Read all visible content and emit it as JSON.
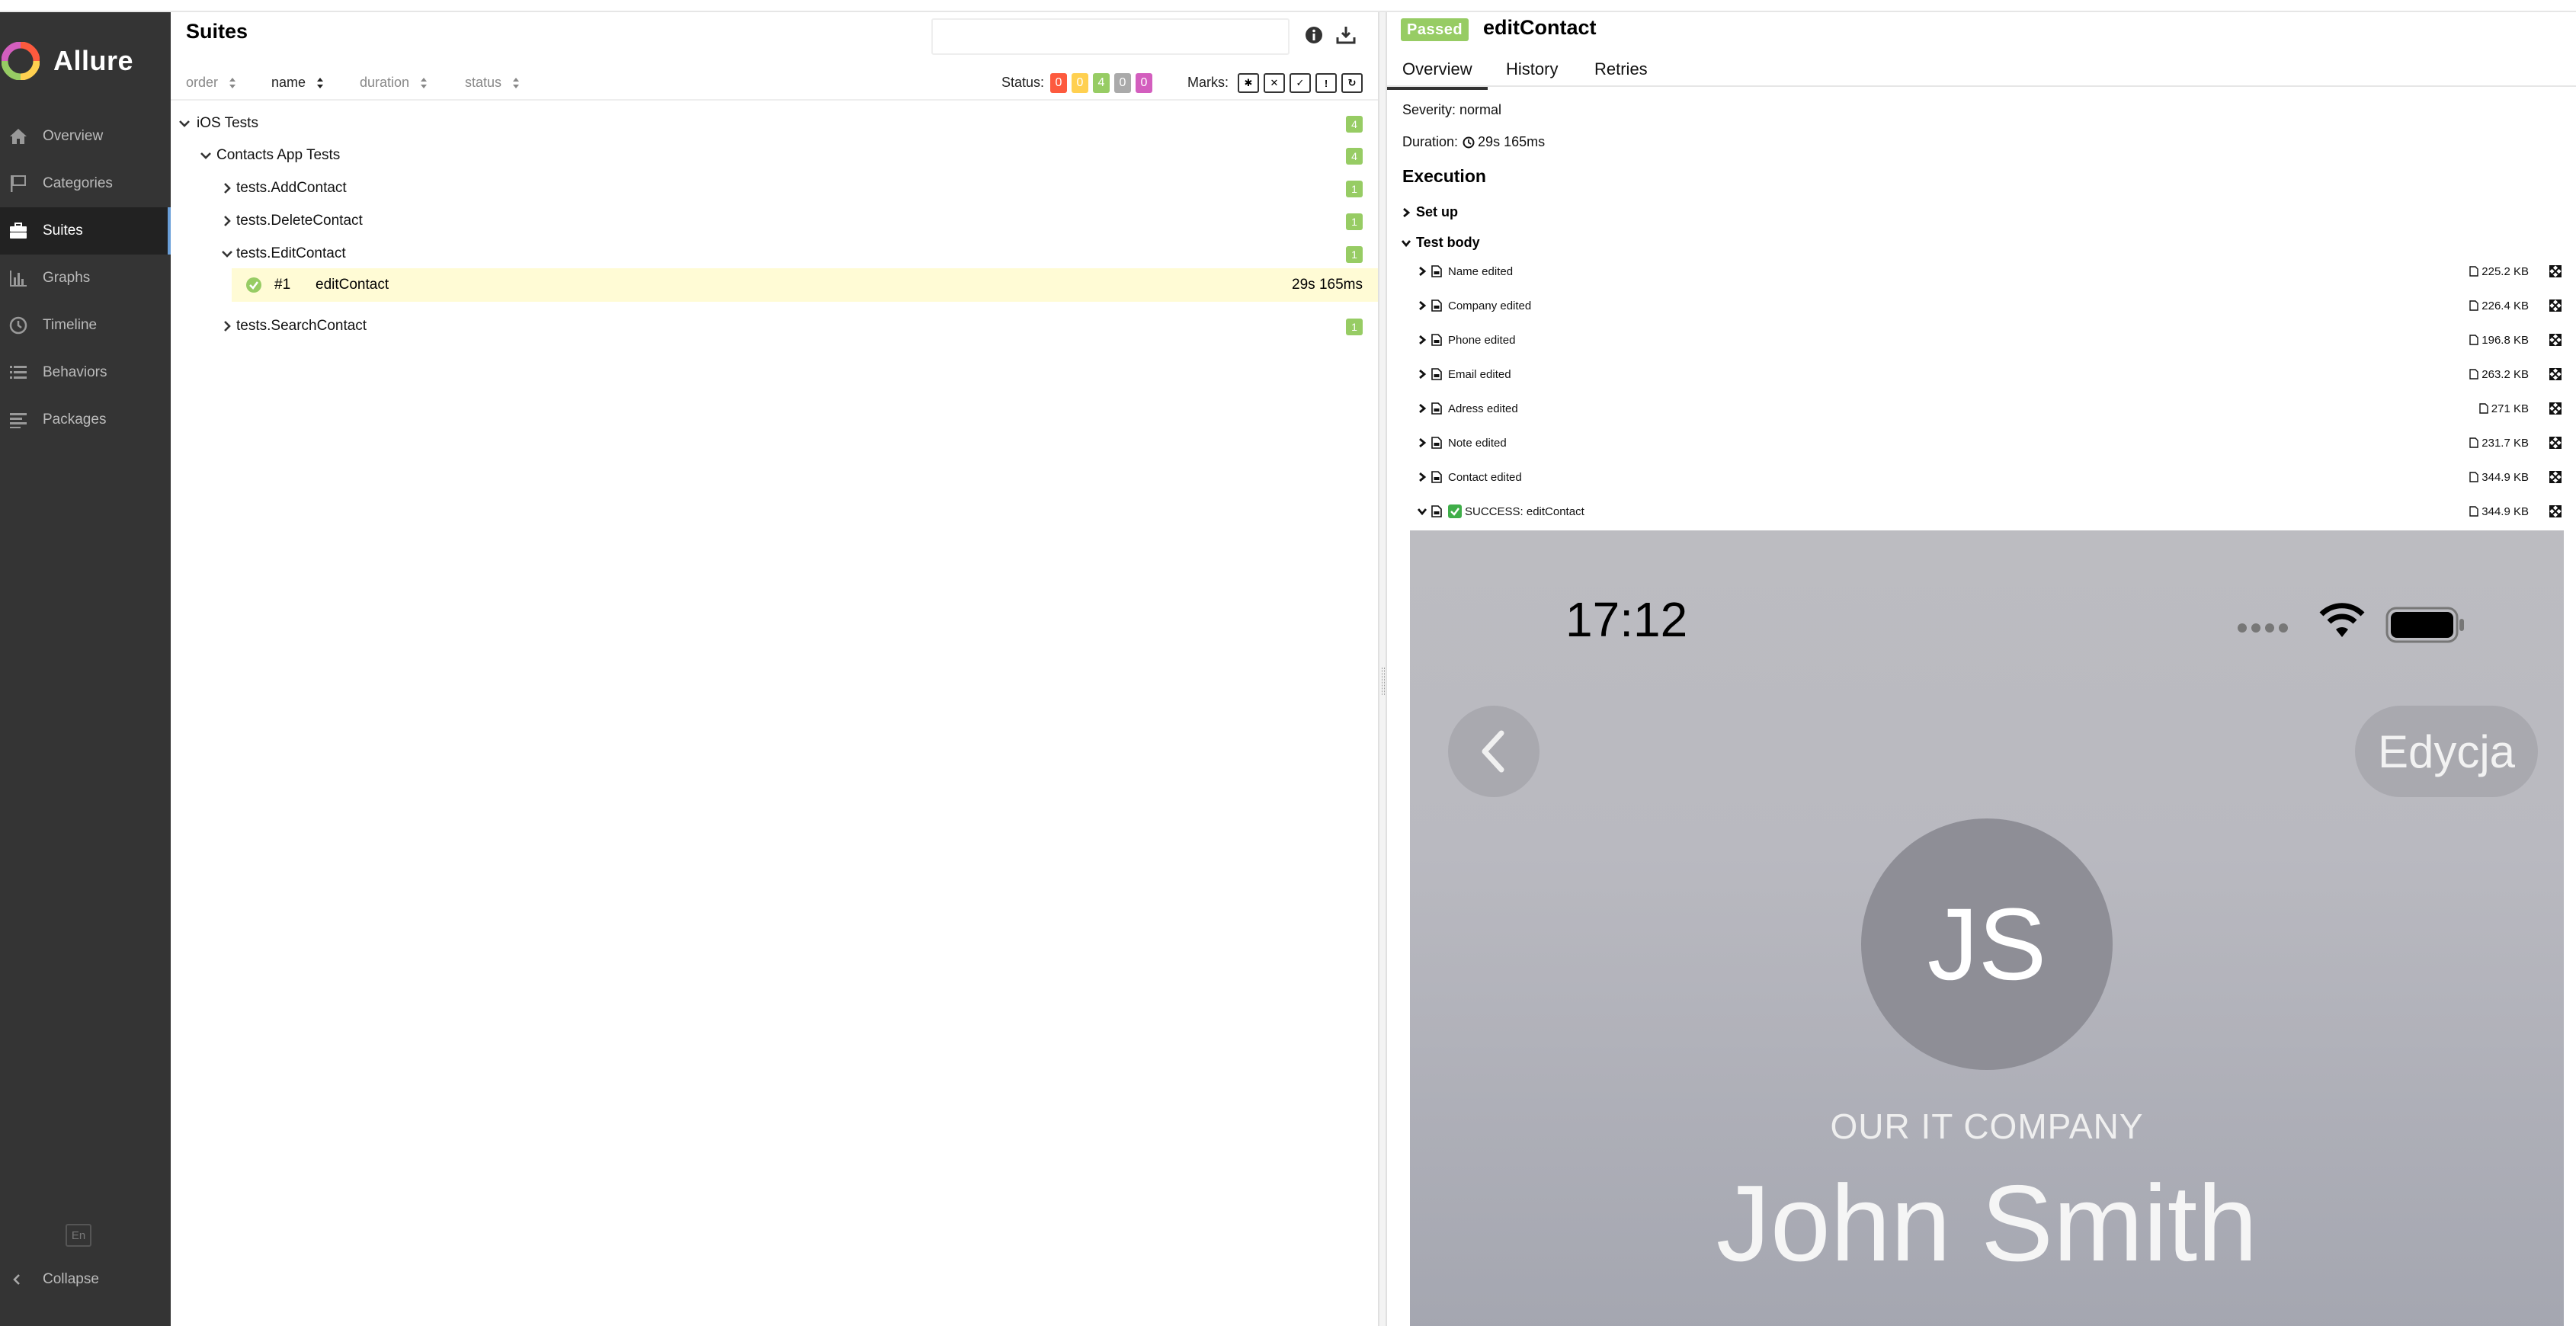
{
  "app": {
    "name": "Allure"
  },
  "sidebar": {
    "items": [
      {
        "label": "Overview",
        "icon": "home-icon"
      },
      {
        "label": "Categories",
        "icon": "flag-icon"
      },
      {
        "label": "Suites",
        "icon": "briefcase-icon"
      },
      {
        "label": "Graphs",
        "icon": "bar-chart-icon"
      },
      {
        "label": "Timeline",
        "icon": "clock-icon"
      },
      {
        "label": "Behaviors",
        "icon": "list-icon"
      },
      {
        "label": "Packages",
        "icon": "align-left-icon"
      }
    ],
    "active": "Suites",
    "lang": "En",
    "collapse_label": "Collapse"
  },
  "suites": {
    "title": "Suites",
    "search_placeholder": "",
    "sort": {
      "order": "order",
      "name": "name",
      "duration": "duration",
      "status": "status"
    },
    "status_label": "Status:",
    "status_counts": [
      {
        "value": "0",
        "color": "#fd5a3e"
      },
      {
        "value": "0",
        "color": "#ffd050"
      },
      {
        "value": "4",
        "color": "#97cc64"
      },
      {
        "value": "0",
        "color": "#aaaaaa"
      },
      {
        "value": "0",
        "color": "#d35ebe"
      }
    ],
    "marks_label": "Marks:",
    "marks": [
      "flaky-icon",
      "new-failed-icon",
      "new-passed-icon",
      "new-broken-icon",
      "retries-icon"
    ],
    "tree": [
      {
        "label": "iOS Tests",
        "count": "4",
        "expanded": true
      },
      {
        "label": "Contacts App Tests",
        "count": "4",
        "expanded": true
      },
      {
        "label": "tests.AddContact",
        "count": "1",
        "expanded": false
      },
      {
        "label": "tests.DeleteContact",
        "count": "1",
        "expanded": false
      },
      {
        "label": "tests.EditContact",
        "count": "1",
        "expanded": true
      },
      {
        "label": "tests.SearchContact",
        "count": "1",
        "expanded": false
      }
    ],
    "selected_test": {
      "number": "#1",
      "name": "editContact",
      "duration": "29s 165ms",
      "status": "passed"
    }
  },
  "detail": {
    "status": "Passed",
    "title": "editContact",
    "tabs": [
      "Overview",
      "History",
      "Retries"
    ],
    "active_tab": "Overview",
    "severity": "Severity: normal",
    "duration_label": "Duration:",
    "duration": "29s 165ms",
    "execution_title": "Execution",
    "setup_label": "Set up",
    "testbody_label": "Test body",
    "steps": [
      {
        "name": "Name edited",
        "size": "225.2 KB"
      },
      {
        "name": "Company edited",
        "size": "226.4 KB"
      },
      {
        "name": "Phone edited",
        "size": "196.8 KB"
      },
      {
        "name": "Email edited",
        "size": "263.2 KB"
      },
      {
        "name": "Adress edited",
        "size": "271 KB"
      },
      {
        "name": "Note edited",
        "size": "231.7 KB"
      },
      {
        "name": "Contact edited",
        "size": "344.9 KB"
      },
      {
        "name": "SUCCESS: editContact",
        "size": "344.9 KB",
        "expanded": true
      }
    ]
  },
  "attachment": {
    "time": "17:12",
    "edit_label": "Edycja",
    "initials": "JS",
    "company": "OUR IT COMPANY",
    "contact_name": "John Smith"
  }
}
